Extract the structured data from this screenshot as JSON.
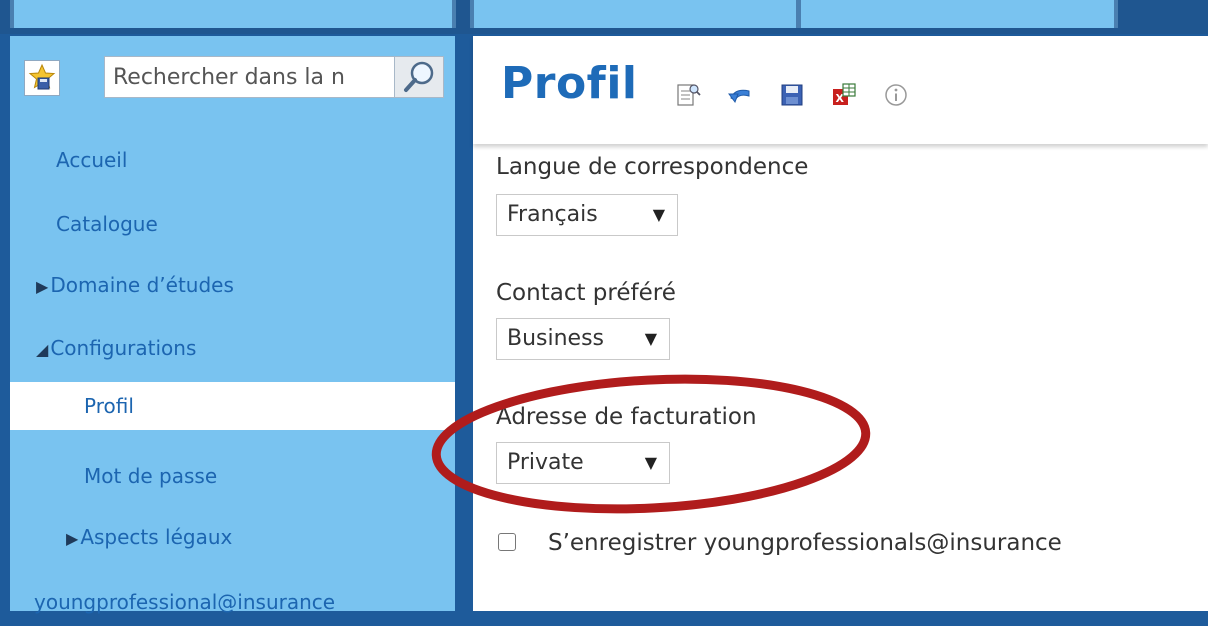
{
  "search": {
    "placeholder": "Rechercher dans la n"
  },
  "sidebar": {
    "items": [
      {
        "label": "Accueil",
        "arrow": ""
      },
      {
        "label": "Catalogue",
        "arrow": ""
      },
      {
        "label": "Domaine d’études",
        "arrow": "▶"
      },
      {
        "label": "Configurations",
        "arrow": "◢"
      },
      {
        "label": "Profil",
        "arrow": ""
      },
      {
        "label": "Mot de passe",
        "arrow": ""
      },
      {
        "label": "Aspects légaux",
        "arrow": "▶"
      },
      {
        "label": "youngprofessional@insurance",
        "arrow": ""
      }
    ]
  },
  "page": {
    "title": "Profil",
    "toolbar": [
      "preview-icon",
      "undo-icon",
      "save-icon",
      "export-icon",
      "info-icon"
    ]
  },
  "form": {
    "language": {
      "label": "Langue de correspondence",
      "value": "Français"
    },
    "contact": {
      "label": "Contact préféré",
      "value": "Business"
    },
    "billing": {
      "label": "Adresse de facturation",
      "value": "Private"
    },
    "subscribe": {
      "label": "S’enregistrer youngprofessionals@insurance",
      "checked": false
    }
  },
  "colors": {
    "accent": "#1e6bb8",
    "sidebar": "#79c3f0",
    "frame": "#1e5b9b",
    "highlight": "#b01c1c"
  }
}
